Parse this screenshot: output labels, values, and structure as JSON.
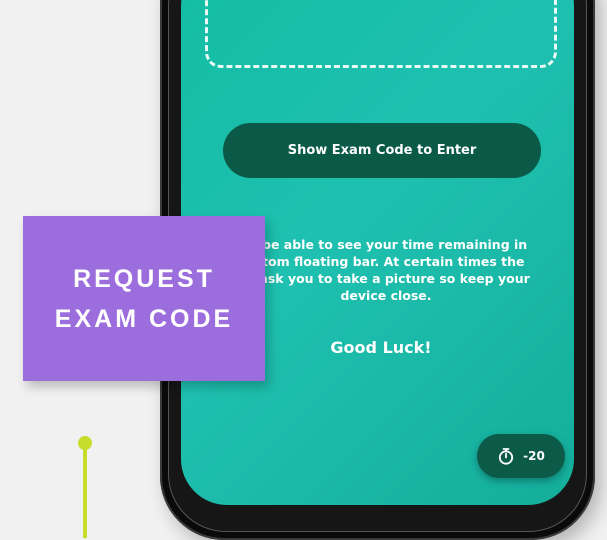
{
  "screen": {
    "exam_button_label": "Show Exam Code to Enter",
    "info_lines": [
      "ill be able to see your time remaining in",
      "ottom floating bar. At certain times the",
      "ill ask you to take a picture so keep your",
      "device close."
    ],
    "good_luck": "Good Luck!",
    "timer": {
      "icon": "stopwatch-icon",
      "value": "-20"
    }
  },
  "callout": {
    "line1": "REQUEST",
    "line2": "EXAM CODE",
    "color": "#9b6ddd"
  },
  "colors": {
    "screen_teal": "#1fc0b0",
    "button_dark_green": "#0b5a47",
    "connector_lime": "#c8dc2c",
    "background": "#f1f1f1"
  }
}
